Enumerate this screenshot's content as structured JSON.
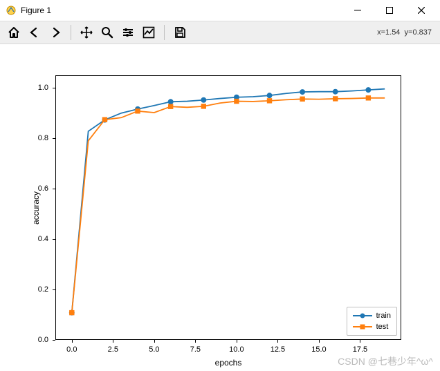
{
  "window": {
    "title": "Figure 1"
  },
  "toolbar": {
    "coords": "x=1.54  y=0.837"
  },
  "watermark": "CSDN @七巷少年^ω^",
  "chart_data": {
    "type": "line",
    "xlabel": "epochs",
    "ylabel": "accuracy",
    "xlim": [
      -1,
      20
    ],
    "ylim": [
      0.0,
      1.05
    ],
    "xticks": [
      0.0,
      2.5,
      5.0,
      7.5,
      10.0,
      12.5,
      15.0,
      17.5
    ],
    "yticks": [
      0.0,
      0.2,
      0.4,
      0.6,
      0.8,
      1.0
    ],
    "legend_position": "lower right",
    "marker_spacing": 2,
    "series": [
      {
        "name": "train",
        "color": "#1f77b4",
        "marker": "circle",
        "x": [
          0,
          1,
          2,
          3,
          4,
          5,
          6,
          7,
          8,
          9,
          10,
          11,
          12,
          13,
          14,
          15,
          16,
          17,
          18,
          19
        ],
        "y": [
          0.108,
          0.828,
          0.873,
          0.9,
          0.916,
          0.93,
          0.945,
          0.947,
          0.952,
          0.958,
          0.963,
          0.965,
          0.97,
          0.978,
          0.984,
          0.985,
          0.985,
          0.988,
          0.992,
          0.996
        ]
      },
      {
        "name": "test",
        "color": "#ff7f0e",
        "marker": "square",
        "x": [
          0,
          1,
          2,
          3,
          4,
          5,
          6,
          7,
          8,
          9,
          10,
          11,
          12,
          13,
          14,
          15,
          16,
          17,
          18,
          19
        ],
        "y": [
          0.108,
          0.79,
          0.874,
          0.882,
          0.908,
          0.902,
          0.926,
          0.923,
          0.927,
          0.94,
          0.947,
          0.946,
          0.949,
          0.953,
          0.956,
          0.955,
          0.957,
          0.958,
          0.96,
          0.96
        ]
      }
    ]
  }
}
